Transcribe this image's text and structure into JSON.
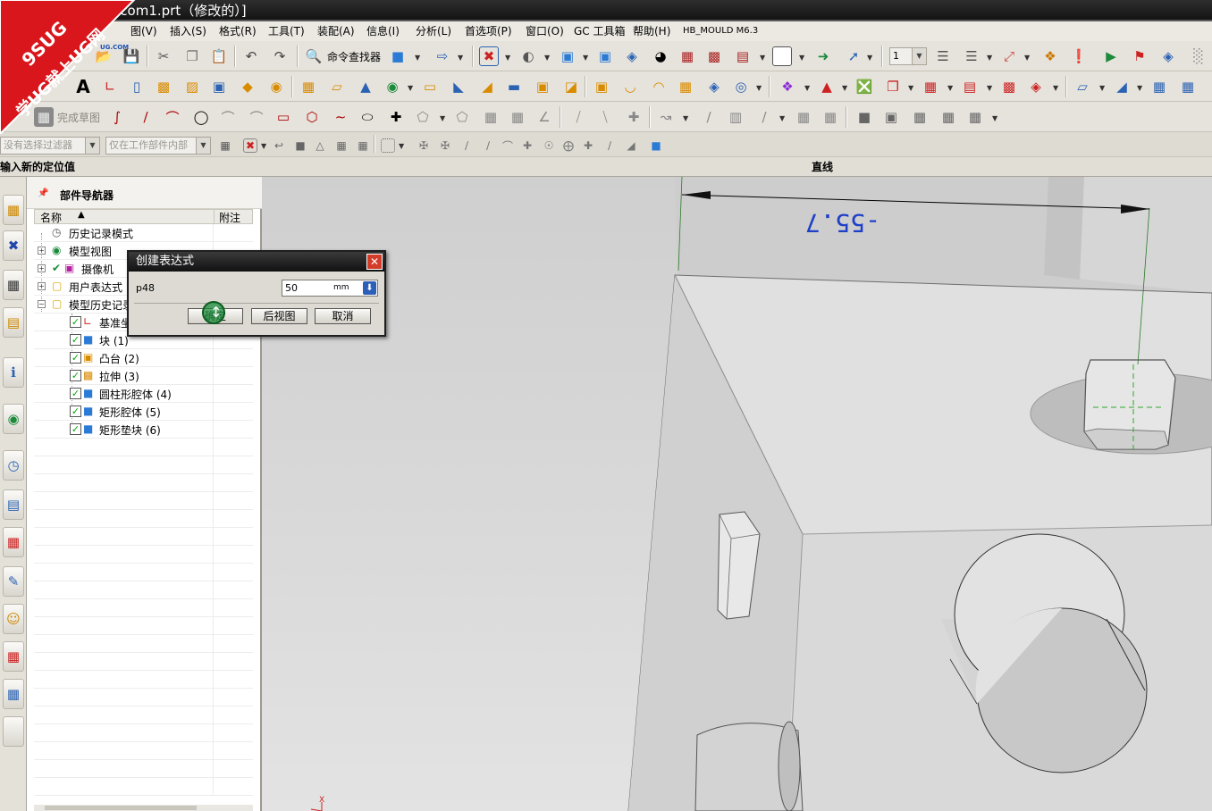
{
  "window": {
    "title": "g.com1.prt（修改的）]"
  },
  "watermark": {
    "line1": "9SUG",
    "line2": "学UG就上UG网",
    "line3": "UG.COM"
  },
  "menu": {
    "items": [
      "图(V)",
      "插入(S)",
      "格式(R)",
      "工具(T)",
      "装配(A)",
      "信息(I)",
      "分析(L)",
      "首选项(P)",
      "窗口(O)",
      "GC 工具箱",
      "帮助(H)",
      "HB_MOULD M6.3"
    ]
  },
  "toolbar": {
    "command_finder": "命令查找器",
    "finish_sketch": "完成草图",
    "layer_value": "1"
  },
  "selection_bar": {
    "filter_placeholder": "没有选择过滤器",
    "scope_placeholder": "仅在工作部件内部"
  },
  "status": {
    "prompt": "输入新的定位值",
    "right": "直线"
  },
  "navigator": {
    "title": "部件导航器",
    "col_name": "名称",
    "col_note": "附注",
    "nodes": [
      {
        "label": "历史记录模式",
        "icon": "history-mode-icon"
      },
      {
        "label": "模型视图",
        "icon": "model-views-icon"
      },
      {
        "label": "摄像机",
        "icon": "camera-icon"
      },
      {
        "label": "用户表达式",
        "icon": "folder-icon"
      },
      {
        "label": "模型历史记录",
        "icon": "folder-icon"
      },
      {
        "label": "基准坐",
        "icon": "datum-csys-icon"
      },
      {
        "label": "块 (1)",
        "icon": "block-icon"
      },
      {
        "label": "凸台 (2)",
        "icon": "boss-icon"
      },
      {
        "label": "拉伸 (3)",
        "icon": "extrude-icon"
      },
      {
        "label": "圆柱形腔体 (4)",
        "icon": "cylindrical-pocket-icon"
      },
      {
        "label": "矩形腔体 (5)",
        "icon": "rectangular-pocket-icon"
      },
      {
        "label": "矩形垫块 (6)",
        "icon": "rectangular-pad-icon"
      }
    ]
  },
  "dialog": {
    "title": "创建表达式",
    "param_name": "p48",
    "value": "50",
    "unit": "mm",
    "ok": "确定",
    "back": "后视图",
    "cancel": "取消"
  },
  "viewport": {
    "dimension_text": "-55.7",
    "axis_label": "X"
  },
  "colors": {
    "titlebar": "#1a1a1a",
    "accent_blue": "#2d5fb8",
    "dimension": "#1e3fc8",
    "close_red": "#d43c2a",
    "cursor_green": "#1e8c3c"
  }
}
